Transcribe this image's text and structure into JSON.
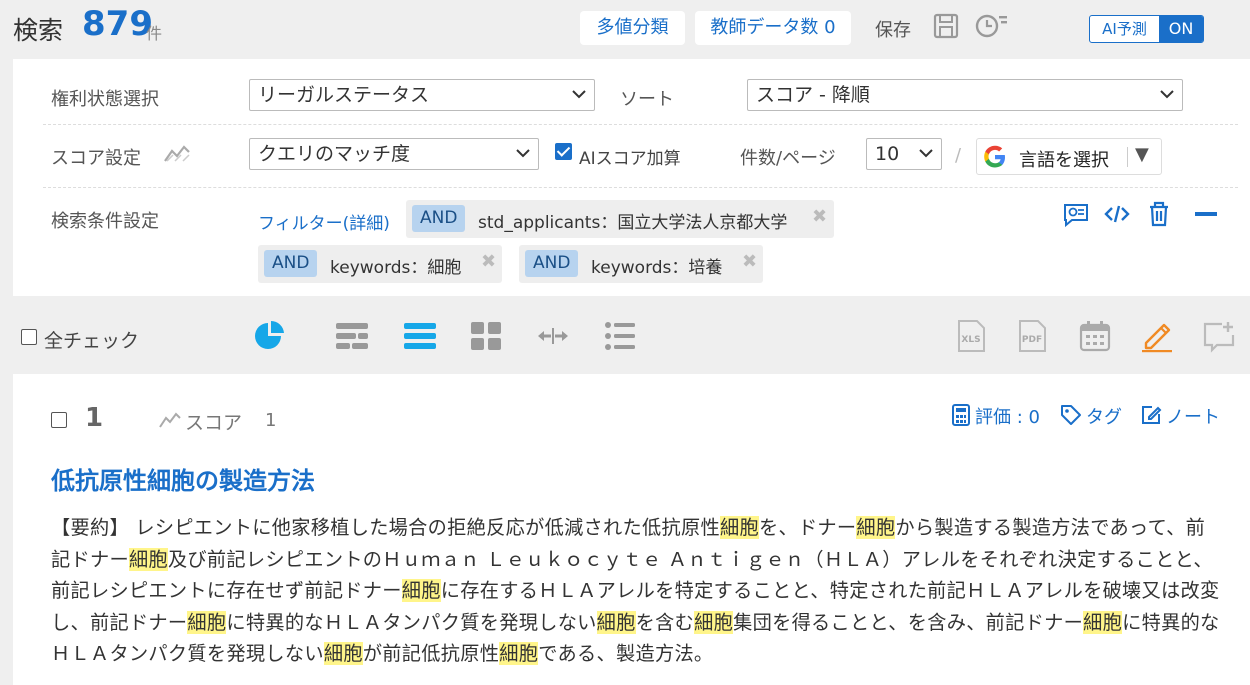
{
  "header": {
    "title": "検索",
    "count": "879",
    "unit": "件",
    "multi_class_label": "多値分類",
    "teacher_data_label": "教師データ数 0",
    "save_label": "保存",
    "ai_predict_label": "AI予測",
    "ai_predict_state": "ON"
  },
  "settings": {
    "rights_label": "権利状態選択",
    "rights_value": "リーガルステータス",
    "sort_label": "ソート",
    "sort_value": "スコア - 降順",
    "score_label": "スコア設定",
    "score_value": "クエリのマッチ度",
    "ai_score_label": "AIスコア加算",
    "ai_score_checked": true,
    "per_page_label": "件数/ページ",
    "per_page_value": "10",
    "slash": "/",
    "language_label": "言語を選択",
    "language_arrow": "▼",
    "conditions_label": "検索条件設定",
    "filter_link": "フィルター(詳細)",
    "filters": [
      {
        "op": "AND",
        "text": "std_applicants：国立大学法人京都大学"
      },
      {
        "op": "AND",
        "text": "keywords：細胞"
      },
      {
        "op": "AND",
        "text": "keywords：培養"
      }
    ]
  },
  "toolbar": {
    "check_all_label": "全チェック",
    "icons": [
      "pie-chart-icon",
      "list-detailed-icon",
      "list-compact-icon",
      "grid-icon",
      "expand-horizontal-icon",
      "bullet-list-icon",
      "xls-export-icon",
      "pdf-export-icon",
      "calendar-icon",
      "edit-icon",
      "add-window-icon"
    ]
  },
  "result": {
    "number": "1",
    "score_label": "スコア",
    "score_value": "1",
    "rating_label": "評価 : 0",
    "tag_label": "タグ",
    "note_label": "ノート",
    "title": "低抗原性細胞の製造方法",
    "abstract_segments": [
      {
        "t": "【要約】 レシピエントに他家移植した場合の拒絶反応が低減された低抗原性",
        "hl": false
      },
      {
        "t": "細胞",
        "hl": true
      },
      {
        "t": "を、ドナー",
        "hl": false
      },
      {
        "t": "細胞",
        "hl": true
      },
      {
        "t": "から製造する製造方法であって、前記ドナー",
        "hl": false
      },
      {
        "t": "細胞",
        "hl": true
      },
      {
        "t": "及び前記レシピエントのＨｕｍａｎ Ｌｅｕｋｏｃｙｔｅ Ａｎｔｉｇｅｎ（ＨＬＡ）アレルをそれぞれ決定することと、前記レシピエントに存在せず前記ドナー",
        "hl": false
      },
      {
        "t": "細胞",
        "hl": true
      },
      {
        "t": "に存在するＨＬＡアレルを特定することと、特定された前記ＨＬＡアレルを破壊又は改変し、前記ドナー",
        "hl": false
      },
      {
        "t": "細胞",
        "hl": true
      },
      {
        "t": "に特異的なＨＬＡタンパク質を発現しない",
        "hl": false
      },
      {
        "t": "細胞",
        "hl": true
      },
      {
        "t": "を含む",
        "hl": false
      },
      {
        "t": "細胞",
        "hl": true
      },
      {
        "t": "集団を得ることと、を含み、前記ドナー",
        "hl": false
      },
      {
        "t": "細胞",
        "hl": true
      },
      {
        "t": "に特異的なＨＬＡタンパク質を発現しない",
        "hl": false
      },
      {
        "t": "細胞",
        "hl": true
      },
      {
        "t": "が前記低抗原性",
        "hl": false
      },
      {
        "t": "細胞",
        "hl": true
      },
      {
        "t": "である、製造方法。",
        "hl": false
      }
    ]
  },
  "colors": {
    "accent": "#1a6fc9",
    "highlight": "#fff58a",
    "edit_orange": "#f08a24",
    "chip_and": "#b7d3ef",
    "pie_cyan": "#16a7e8"
  }
}
